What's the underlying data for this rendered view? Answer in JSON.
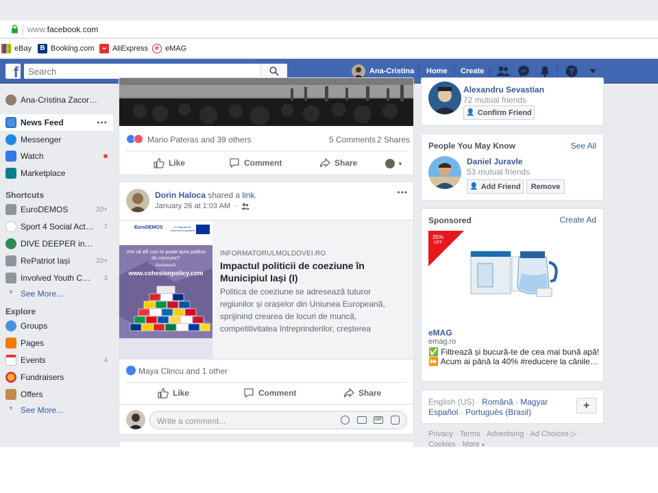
{
  "browser": {
    "url_prefix": "www.",
    "url_domain": "facebook.com",
    "bookmarks": [
      {
        "label": "eBay"
      },
      {
        "label": "Booking.com"
      },
      {
        "label": "AliExpress"
      },
      {
        "label": "eMAG"
      }
    ]
  },
  "topbar": {
    "search_placeholder": "Search",
    "user_name": "Ana-Cristina",
    "home": "Home",
    "create": "Create"
  },
  "sidebar": {
    "profile": "Ana-Cristina Zacor…",
    "items": [
      {
        "label": "News Feed"
      },
      {
        "label": "Messenger"
      },
      {
        "label": "Watch"
      },
      {
        "label": "Marketplace"
      }
    ],
    "shortcuts_heading": "Shortcuts",
    "shortcuts": [
      {
        "label": "EuroDEMOS",
        "count": "20+"
      },
      {
        "label": "Sport 4 Social Action",
        "count": "7"
      },
      {
        "label": "DIVE DEEPER into…",
        "count": ""
      },
      {
        "label": "RePatriot Iași",
        "count": "20+"
      },
      {
        "label": "Involved Youth Co…",
        "count": "3"
      }
    ],
    "see_more": "See More...",
    "explore_heading": "Explore",
    "explore": [
      {
        "label": "Groups",
        "count": ""
      },
      {
        "label": "Pages",
        "count": ""
      },
      {
        "label": "Events",
        "count": "4"
      },
      {
        "label": "Fundraisers",
        "count": ""
      },
      {
        "label": "Offers",
        "count": ""
      }
    ],
    "see_more_2": "See More..."
  },
  "post1": {
    "reactions_text": "Mario Pateras and 39 others",
    "comments": "5 Comments",
    "shares": "2 Shares",
    "like": "Like",
    "comment": "Comment",
    "share": "Share"
  },
  "post2": {
    "author": "Dorin Haloca",
    "shared_a": "shared a",
    "link_word": "link.",
    "time": "January 26 at 1:03 AM",
    "more": "•••",
    "link_source": "INFORMATORULMOLDOVEI.RO",
    "link_title": "Impactul politicii de coeziune în Municipiul Iași (I)",
    "link_desc": "Politica de coeziune se adresează tuturor regiunilor și orașelor din Uniunea Europeană, sprijinind crearea de locuri de muncă, competitivitatea întreprinderilor, creșterea",
    "thumb_brand": "EuroDEMOS",
    "thumb_cofinanced": "Co-finanțat de Uniunea Europeană",
    "thumb_question": "Vrei să afli cum te poate ajuta politica de coeziune?",
    "thumb_access": "Accesează:",
    "thumb_url": "www.cohesionpolicy.com",
    "reactions_text": "Maya Clincu and 1 other",
    "like": "Like",
    "comment": "Comment",
    "share": "Share",
    "comment_placeholder": "Write a comment..."
  },
  "right": {
    "friend_request": {
      "name": "Alexandru Sevastian",
      "mutual": "72 mutual friends",
      "confirm": "Confirm Friend"
    },
    "pymk": {
      "heading": "People You May Know",
      "see_all": "See All",
      "name": "Daniel Juravle",
      "mutual": "53 mutual friends",
      "add": "Add Friend",
      "remove": "Remove"
    },
    "sponsored": {
      "heading": "Sponsored",
      "create_ad": "Create Ad",
      "badge_pct": "35%",
      "badge_off": "OFF",
      "advertiser": "eMAG",
      "domain": "emag.ro",
      "line1": "✅ Filtrează și bucură-te de cea mai bună apă!",
      "line2": "⏩ Acum ai până la 40% #reducere la cănile…"
    },
    "languages": {
      "current": "English (US)",
      "options": [
        "Română",
        "Magyar",
        "Español",
        "Português (Brasil)"
      ],
      "add": "+"
    },
    "footer": {
      "links": [
        "Privacy",
        "Terms",
        "Advertising",
        "Ad Choices",
        "Cookies",
        "More"
      ]
    }
  },
  "colors": {
    "fb_blue": "#4267b2",
    "link": "#365899",
    "bg": "#e9ebee"
  }
}
